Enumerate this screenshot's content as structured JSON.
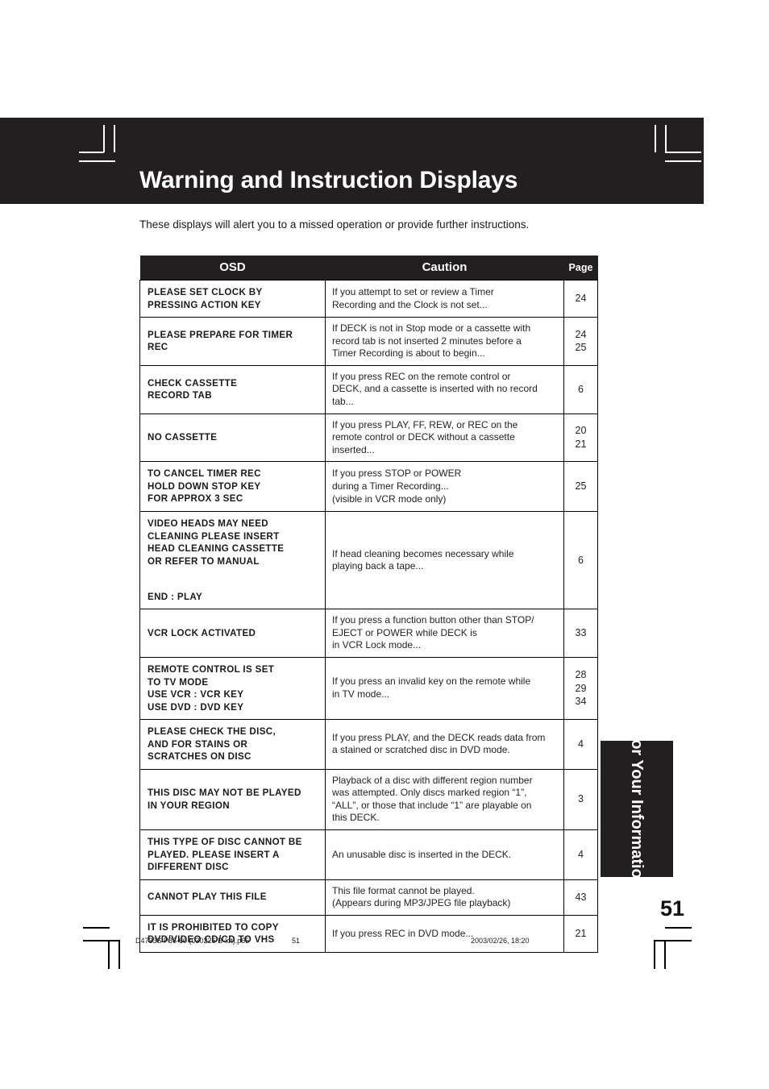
{
  "page": {
    "title": "Warning and Instruction Displays",
    "intro": "These displays will alert you to a missed operation or provide further instructions.",
    "page_number": "51",
    "side_tab": "For Your Information"
  },
  "table": {
    "headers": {
      "osd": "OSD",
      "caution": "Caution",
      "page": "Page"
    },
    "rows": [
      {
        "osd": "PLEASE SET CLOCK BY\nPRESSING ACTION KEY",
        "caution": "If you attempt to set or review a Timer\nRecording and the Clock is not set...",
        "page": "24"
      },
      {
        "osd": "PLEASE PREPARE FOR TIMER\nREC",
        "caution": "If DECK is not in Stop mode or a cassette with\nrecord tab is not inserted 2 minutes before a\nTimer Recording is about to begin...",
        "page": "24\n25"
      },
      {
        "osd": "CHECK CASSETTE\nRECORD TAB",
        "caution": "If you press REC on the remote control or\nDECK, and a cassette is inserted with no record\ntab...",
        "page": "6"
      },
      {
        "osd": "NO CASSETTE",
        "caution": "If you press PLAY, FF, REW, or REC on the\nremote control or DECK without a cassette\ninserted...",
        "page": "20\n21"
      },
      {
        "osd": "TO CANCEL TIMER REC\nHOLD DOWN STOP KEY\nFOR APPROX 3 SEC",
        "caution": "If you press STOP or POWER\nduring a Timer Recording...\n(visible in VCR mode only)",
        "page": "25"
      },
      {
        "osd": "VIDEO HEADS MAY NEED\nCLEANING PLEASE INSERT\nHEAD CLEANING CASSETTE\nOR REFER TO MANUAL\n\nEND          : PLAY",
        "caution": "If head cleaning becomes necessary while\nplaying back a tape...",
        "page": "6"
      },
      {
        "osd": "VCR LOCK ACTIVATED",
        "caution": "If you press a function button other than STOP/\nEJECT or POWER while DECK is\nin VCR Lock mode...",
        "page": "33"
      },
      {
        "osd": "REMOTE CONTROL IS SET\nTO TV MODE\nUSE VCR : VCR KEY\nUSE DVD : DVD KEY",
        "caution": "If you press an invalid key on the remote while\nin TV mode...",
        "page": "28\n29\n34"
      },
      {
        "osd": "PLEASE CHECK THE DISC,\nAND FOR STAINS OR\nSCRATCHES ON DISC",
        "caution": "If you press PLAY, and the DECK reads data from\na stained or scratched disc in DVD mode.",
        "page": "4"
      },
      {
        "osd": "THIS DISC MAY NOT BE PLAYED\nIN YOUR REGION",
        "caution": "Playback of a disc with different region number\nwas attempted. Only discs marked region “1”,\n“ALL”, or those that include “1” are playable on\nthis DECK.",
        "page": "3"
      },
      {
        "osd": "THIS TYPE OF DISC CANNOT BE\nPLAYED. PLEASE INSERT A\nDIFFERENT DISC",
        "caution": "An unusable disc is inserted in the DECK.",
        "page": "4"
      },
      {
        "osd": "CANNOT PLAY THIS FILE",
        "caution": "This file format cannot be played.\n(Appears during MP3/JPEG file playback)",
        "page": "43"
      },
      {
        "osd": "IT IS PROHIBITED TO COPY\nDVD/VIDEO CD/CD TO VHS",
        "caution": "If you press REC in DVD mode...",
        "page": "21"
      }
    ]
  },
  "footer": {
    "file": "D4733S P36-60 (030226 B-lot).p65",
    "page": "51",
    "date": "2003/02/26, 18:20"
  },
  "colors": {
    "header_bg": "#231f20",
    "page_bg": "#ffffff",
    "text": "#1a1a1a"
  }
}
